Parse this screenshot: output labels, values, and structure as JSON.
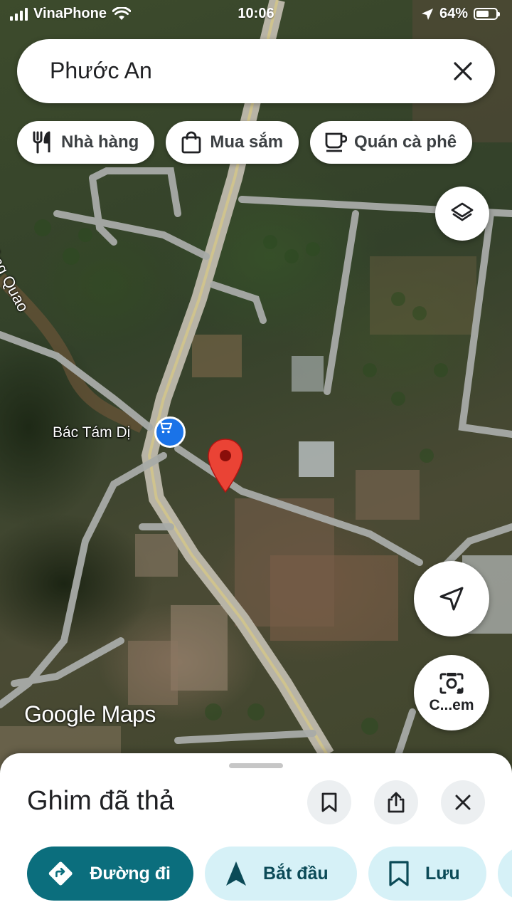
{
  "status_bar": {
    "carrier": "VinaPhone",
    "time": "10:06",
    "battery": "64%",
    "battery_level": 0.64
  },
  "search": {
    "query": "Phước An",
    "close_icon": "close-icon"
  },
  "chips": [
    {
      "label": "Nhà hàng",
      "icon": "restaurant-icon"
    },
    {
      "label": "Mua sắm",
      "icon": "shopping-bag-icon"
    },
    {
      "label": "Quán cà phê",
      "icon": "coffee-icon"
    }
  ],
  "map": {
    "place_label": "Bác Tám Dị",
    "river_label": "ông Quao",
    "logo": {
      "part1": "Google",
      "part2": "Maps"
    },
    "camera_button_label": "C...em"
  },
  "sheet": {
    "title": "Ghim đã thả",
    "actions": [
      {
        "label": "Đường đi",
        "icon": "directions-icon"
      },
      {
        "label": "Bắt đầu",
        "icon": "navigation-arrow-icon"
      },
      {
        "label": "Lưu",
        "icon": "bookmark-icon"
      }
    ]
  },
  "colors": {
    "primary_action": "#0b6e7d",
    "secondary_action": "#d6f1f7",
    "pin_red": "#ea4335",
    "shop_pin_blue": "#1a73e8"
  }
}
